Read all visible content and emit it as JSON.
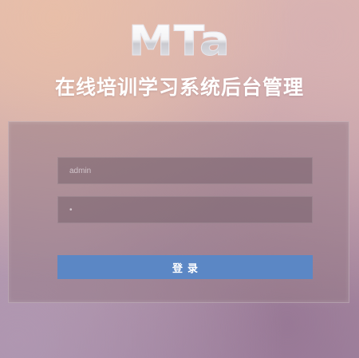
{
  "brand": {
    "logo_text": "MTa"
  },
  "header": {
    "title": "在线培训学习系统后台管理"
  },
  "login_form": {
    "username": {
      "placeholder": "admin",
      "value": ""
    },
    "password": {
      "value": "•"
    },
    "submit_label": "登录"
  },
  "colors": {
    "button": "#5b87c5",
    "title_text": "#ffffff"
  }
}
